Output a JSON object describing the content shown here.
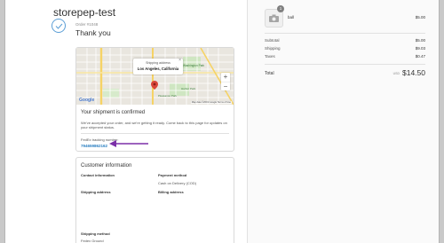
{
  "store": {
    "name": "storepep-test"
  },
  "order": {
    "number": "Order #1048",
    "thank_you": "Thank you"
  },
  "map": {
    "popup_title": "Shipping address",
    "popup_address": "Los Angeles, California",
    "close": "×",
    "zoom_in": "+",
    "zoom_out": "−",
    "logo": "Google",
    "footer": "Map data ©2019 Google   Terms of Use",
    "places": [
      "Washington Park",
      "Pleasance Park",
      "Harbor Park"
    ]
  },
  "shipment": {
    "title": "Your shipment is confirmed",
    "text": "We've accepted your order, and we're getting it ready. Come back to this page for updates on your shipment status.",
    "carrier_label": "FedEx tracking number:",
    "tracking_number": "794659862162"
  },
  "customer": {
    "title": "Customer information",
    "contact_label": "Contact information",
    "payment_label": "Payment method",
    "payment_value": "Cash on Delivery (COD)",
    "shipping_address_label": "Shipping address",
    "billing_address_label": "Billing address",
    "shipping_method_label": "Shipping method",
    "shipping_method_value": "Fedex Ground"
  },
  "summary": {
    "item": {
      "name": "ball",
      "price": "$5.00",
      "quantity": "1"
    },
    "subtotal_label": "Subtotal",
    "subtotal": "$5.00",
    "shipping_label": "Shipping",
    "shipping": "$9.03",
    "taxes_label": "Taxes",
    "taxes": "$0.47",
    "total_label": "Total",
    "currency": "USD",
    "total": "$14.50"
  },
  "colors": {
    "accent": "#2a7fc1",
    "check": "#5b9ed6",
    "arrow": "#7b2fa8",
    "pin": "#d9463a"
  },
  "icons": [
    "check-icon",
    "camera-icon",
    "map-pin-icon",
    "arrow-left-icon"
  ]
}
